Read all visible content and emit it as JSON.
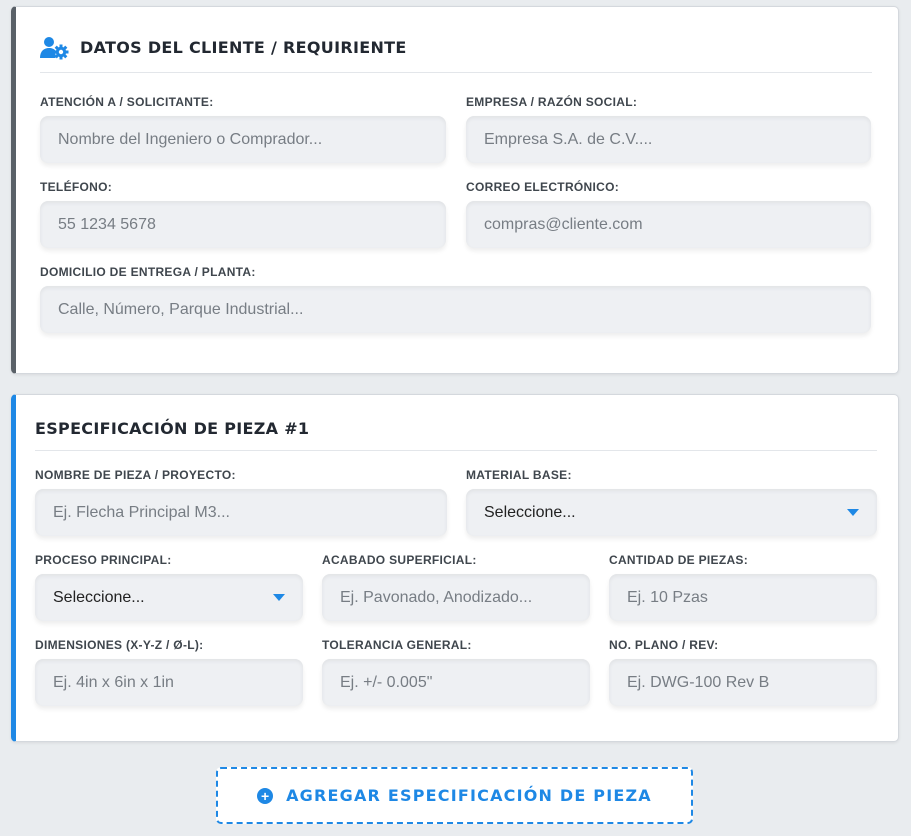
{
  "colors": {
    "accent": "#1e88e5",
    "client_border": "#5a6168",
    "background": "#e9ecef"
  },
  "client_section": {
    "icon": "user-gear-icon",
    "title": "DATOS DEL CLIENTE / REQUIRIENTE",
    "fields": {
      "attention": {
        "label": "ATENCIÓN A / SOLICITANTE:",
        "value": "",
        "placeholder": "Nombre del Ingeniero o Comprador..."
      },
      "company": {
        "label": "EMPRESA / RAZÓN SOCIAL:",
        "value": "",
        "placeholder": "Empresa S.A. de C.V...."
      },
      "phone": {
        "label": "TELÉFONO:",
        "value": "",
        "placeholder": "55 1234 5678"
      },
      "email": {
        "label": "CORREO ELECTRÓNICO:",
        "value": "",
        "placeholder": "compras@cliente.com"
      },
      "address": {
        "label": "DOMICILIO DE ENTREGA / PLANTA:",
        "value": "",
        "placeholder": "Calle, Número, Parque Industrial..."
      }
    }
  },
  "piece_section": {
    "title": "ESPECIFICACIÓN DE PIEZA #1",
    "fields": {
      "piece_name": {
        "label": "NOMBRE DE PIEZA / PROYECTO:",
        "value": "",
        "placeholder": "Ej. Flecha Principal M3..."
      },
      "material": {
        "label": "MATERIAL BASE:",
        "selected": "Seleccione..."
      },
      "process": {
        "label": "PROCESO PRINCIPAL:",
        "selected": "Seleccione..."
      },
      "finish": {
        "label": "ACABADO SUPERFICIAL:",
        "value": "",
        "placeholder": "Ej. Pavonado, Anodizado..."
      },
      "quantity": {
        "label": "CANTIDAD DE PIEZAS:",
        "value": "",
        "placeholder": "Ej. 10 Pzas"
      },
      "dimensions": {
        "label": "DIMENSIONES (X-Y-Z / Ø-L):",
        "value": "",
        "placeholder": "Ej. 4in x 6in x 1in"
      },
      "tolerance": {
        "label": "TOLERANCIA GENERAL:",
        "value": "",
        "placeholder": "Ej. +/- 0.005\""
      },
      "drawing": {
        "label": "NO. PLANO / REV:",
        "value": "",
        "placeholder": "Ej. DWG-100 Rev B"
      }
    }
  },
  "add_button": {
    "icon": "plus-circle-icon",
    "label": "AGREGAR ESPECIFICACIÓN DE PIEZA"
  }
}
